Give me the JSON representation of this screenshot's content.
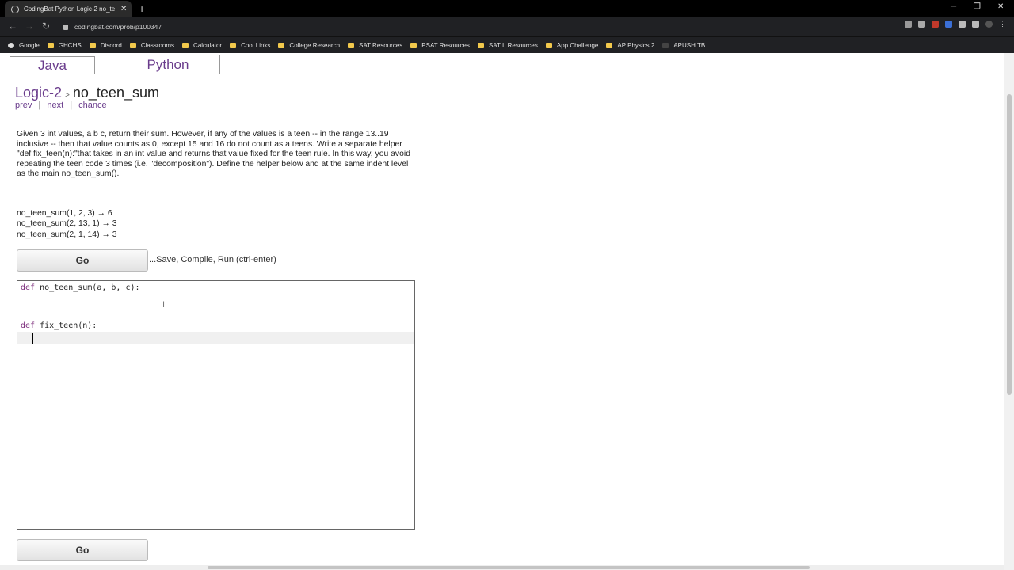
{
  "browser": {
    "tab_title": "CodingBat Python Logic-2 no_te...",
    "tab_close": "✕",
    "new_tab": "+",
    "url": "codingbat.com/prob/p100347",
    "bookmarks": [
      "Google",
      "GHCHS",
      "Discord",
      "Classrooms",
      "Calculator",
      "Cool Links",
      "College Research",
      "SAT Resources",
      "PSAT Resources",
      "SAT II Resources",
      "App Challenge",
      "AP Physics 2",
      "APUSH TB"
    ]
  },
  "page": {
    "lang_tabs": [
      "Java",
      "Python"
    ],
    "section": "Logic-2",
    "separator": ">",
    "problem_name": "no_teen_sum",
    "nav": {
      "prev": "prev",
      "next": "next",
      "chance": "chance"
    },
    "description": "Given 3 int values, a b c, return their sum. However, if any of the values is a teen -- in the range 13..19 inclusive -- then that value counts as 0, except 15 and 16 do not count as a teens. Write a separate helper \"def fix_teen(n):\"that takes in an int value and returns that value fixed for the teen rule. In this way, you avoid repeating the teen code 3 times (i.e. \"decomposition\"). Define the helper below and at the same indent level as the main no_teen_sum().",
    "examples": [
      "no_teen_sum(1, 2, 3) → 6",
      "no_teen_sum(2, 13, 1) → 3",
      "no_teen_sum(2, 1, 14) → 3"
    ],
    "go_label": "Go",
    "go_hint": "...Save, Compile, Run (ctrl-enter)",
    "code": {
      "line1_kw": "def",
      "line1_rest": " no_teen_sum(a, b, c):",
      "line2_kw": "def",
      "line2_rest": " fix_teen(n):"
    }
  }
}
